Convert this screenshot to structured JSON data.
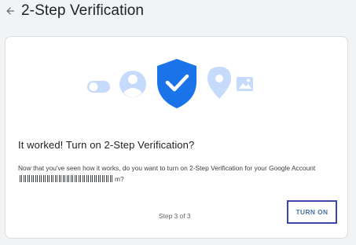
{
  "header": {
    "back_icon": "arrow-back-icon",
    "title": "2-Step Verification"
  },
  "card": {
    "illustration": {
      "icons": [
        "toggle-icon",
        "person-icon",
        "shield-check-icon",
        "location-pin-icon",
        "image-icon"
      ],
      "colors": {
        "light_blue": "#c6dafc",
        "shield_blue": "#1a73e8"
      }
    },
    "heading": "It worked! Turn on 2-Step Verification?",
    "body_before": "Now that you've seen how it works, do you want to turn on 2-Step Verification for your Google Account",
    "body_after": "m?",
    "step_label": "Step 3 of 3",
    "turn_on_label": "TURN ON",
    "accent_color": "#3949ab"
  }
}
